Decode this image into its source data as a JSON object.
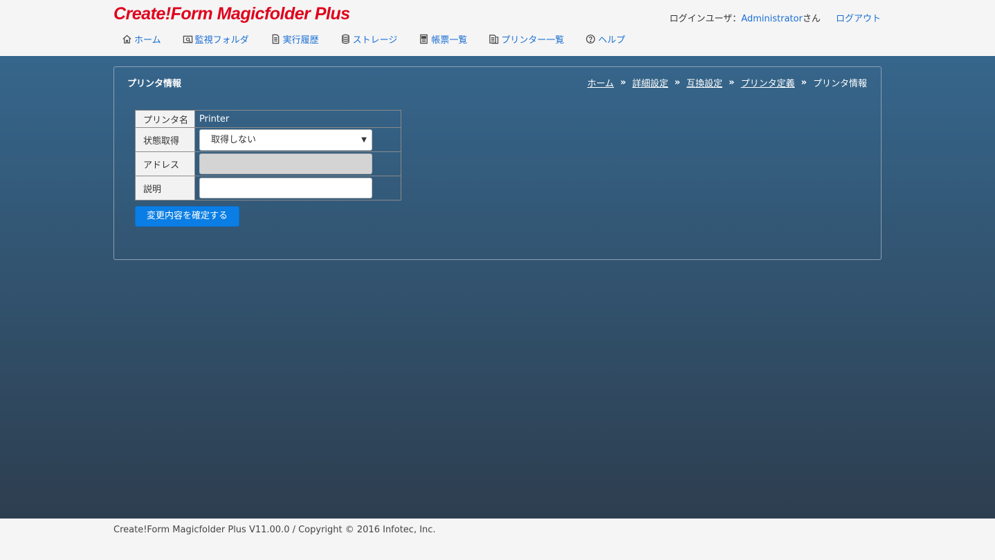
{
  "header": {
    "logo": "Create!Form Magicfolder Plus",
    "user_label": "ログインユーザ：",
    "user_name": "Administrator",
    "user_suffix": "さん",
    "logout": "ログアウト"
  },
  "nav": [
    {
      "label": "ホーム",
      "icon": "home-icon"
    },
    {
      "label": "監視フォルダ",
      "icon": "folder-search-icon"
    },
    {
      "label": "実行履歴",
      "icon": "document-icon"
    },
    {
      "label": "ストレージ",
      "icon": "database-icon"
    },
    {
      "label": "帳票一覧",
      "icon": "report-list-icon"
    },
    {
      "label": "プリンター一覧",
      "icon": "printer-list-icon"
    },
    {
      "label": "ヘルプ",
      "icon": "help-icon"
    }
  ],
  "panel": {
    "title": "プリンタ情報",
    "breadcrumb": [
      "ホーム",
      "詳細設定",
      "互換設定",
      "プリンタ定義"
    ],
    "breadcrumb_current": "プリンタ情報",
    "separator": "»"
  },
  "form": {
    "printer_name_label": "プリンタ名",
    "printer_name_value": "Printer",
    "status_label": "状態取得",
    "status_value": "取得しない",
    "address_label": "アドレス",
    "address_value": "",
    "description_label": "説明",
    "description_value": "",
    "submit": "変更内容を確定する"
  },
  "footer": {
    "text": "Create!Form Magicfolder Plus V11.00.0 / Copyright © 2016 Infotec, Inc."
  },
  "colors": {
    "brand_red": "#e0001b",
    "link_blue": "#1a6fd4",
    "button_blue": "#0a7ee4",
    "bg_top": "#36668c",
    "bg_bottom": "#2d3e4f"
  }
}
